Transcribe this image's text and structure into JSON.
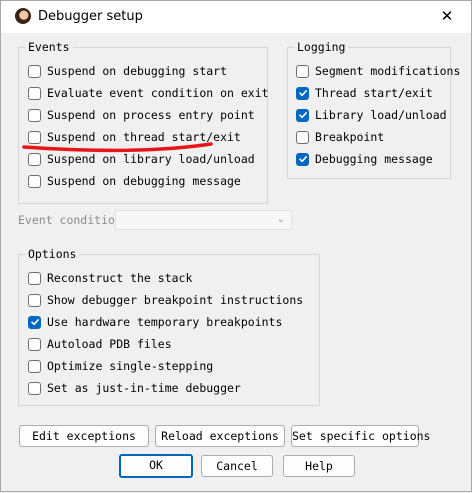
{
  "window": {
    "title": "Debugger setup",
    "close_glyph": "✕"
  },
  "events": {
    "title": "Events",
    "items": [
      {
        "label": "Suspend on debugging start",
        "checked": false
      },
      {
        "label": "Evaluate event condition on exit",
        "checked": false
      },
      {
        "label": "Suspend on process entry point",
        "checked": false
      },
      {
        "label": "Suspend on thread start/exit",
        "checked": false
      },
      {
        "label": "Suspend on library load/unload",
        "checked": false
      },
      {
        "label": "Suspend on debugging message",
        "checked": false
      }
    ]
  },
  "logging": {
    "title": "Logging",
    "items": [
      {
        "label": "Segment modifications",
        "checked": false
      },
      {
        "label": "Thread start/exit",
        "checked": true
      },
      {
        "label": "Library load/unload",
        "checked": true
      },
      {
        "label": "Breakpoint",
        "checked": false
      },
      {
        "label": "Debugging message",
        "checked": true
      }
    ]
  },
  "event_condition": {
    "label": "Event condition",
    "value": "",
    "enabled": false
  },
  "options": {
    "title": "Options",
    "items": [
      {
        "label": "Reconstruct the stack",
        "checked": false
      },
      {
        "label": "Show debugger breakpoint instructions",
        "checked": false
      },
      {
        "label": "Use hardware temporary breakpoints",
        "checked": true
      },
      {
        "label": "Autoload PDB files",
        "checked": false
      },
      {
        "label": "Optimize single-stepping",
        "checked": false
      },
      {
        "label": "Set as just-in-time debugger",
        "checked": false
      }
    ]
  },
  "buttons": {
    "edit_exceptions": "Edit exceptions",
    "reload_exceptions": "Reload exceptions",
    "set_specific_options": "Set specific options",
    "ok": "OK",
    "cancel": "Cancel",
    "help": "Help"
  },
  "colors": {
    "accent": "#0067c0",
    "annotation": "#e8161b"
  }
}
